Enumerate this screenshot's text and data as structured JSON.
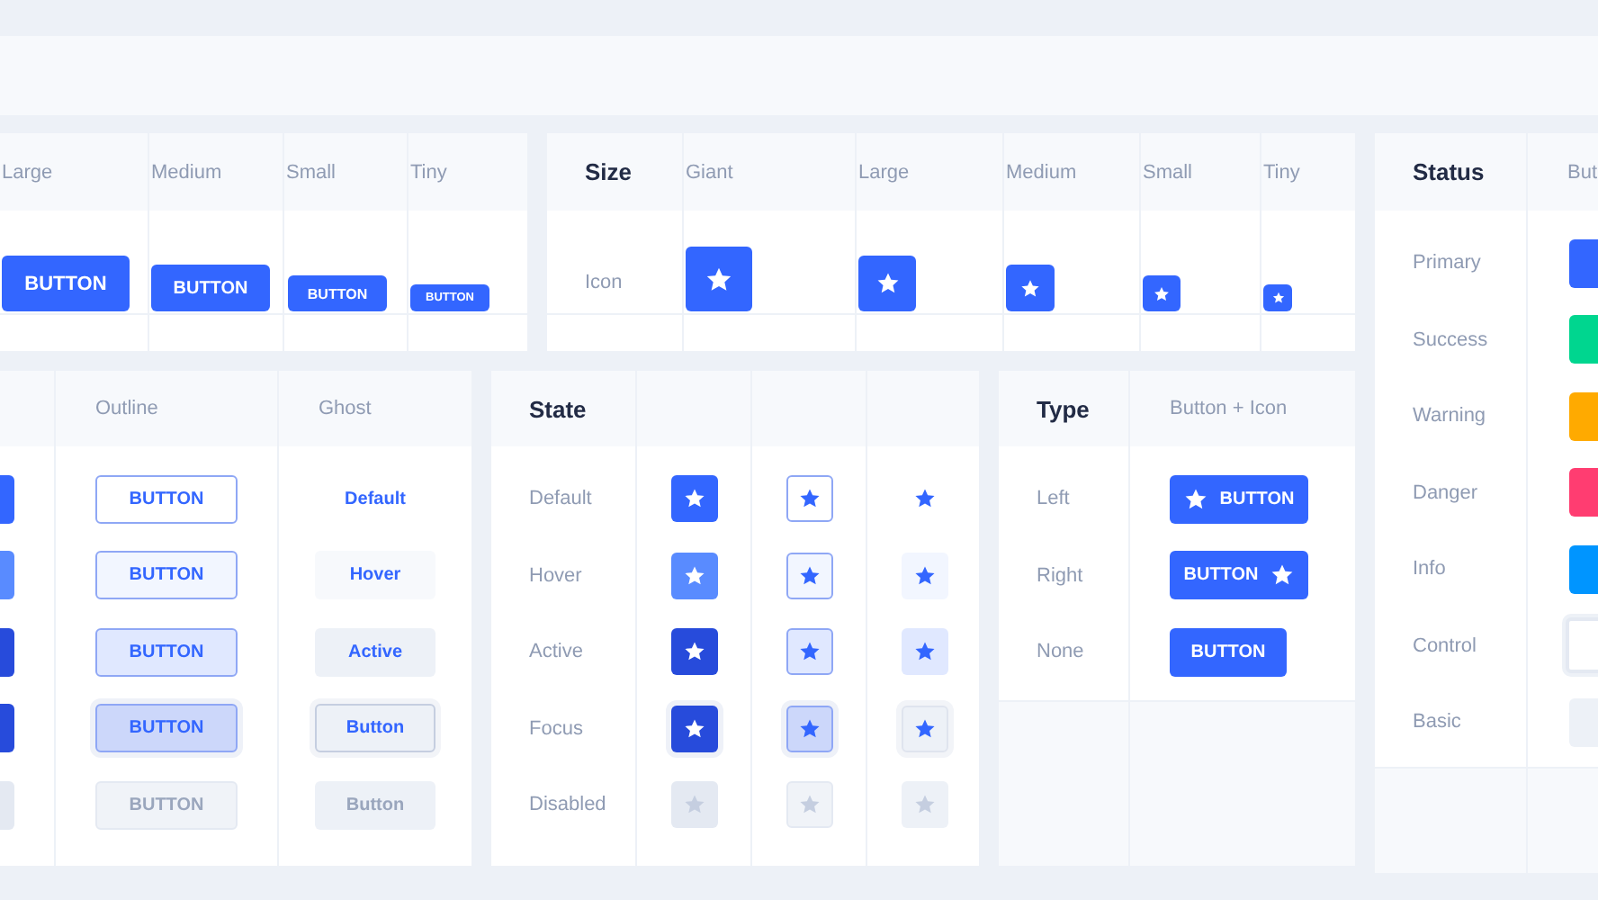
{
  "size_card": {
    "columns": [
      "Large",
      "Medium",
      "Small",
      "Tiny"
    ],
    "buttons": [
      "BUTTON",
      "BUTTON",
      "BUTTON",
      "BUTTON"
    ]
  },
  "icon_size_card": {
    "title": "Size",
    "columns": [
      "Giant",
      "Large",
      "Medium",
      "Small",
      "Tiny"
    ],
    "row_label": "Icon"
  },
  "appearance_card": {
    "columns": [
      "Outline",
      "Ghost"
    ],
    "rows": [
      {
        "kind": "default",
        "outline": "BUTTON",
        "ghost": "Default"
      },
      {
        "kind": "hover",
        "outline": "BUTTON",
        "ghost": "Hover"
      },
      {
        "kind": "active",
        "outline": "BUTTON",
        "ghost": "Active"
      },
      {
        "kind": "focus",
        "outline": "BUTTON",
        "ghost": "Button"
      },
      {
        "kind": "disabled",
        "outline": "BUTTON",
        "ghost": "Button"
      }
    ]
  },
  "state_card": {
    "title": "State",
    "rows": [
      {
        "label": "Default",
        "kind": "default"
      },
      {
        "label": "Hover",
        "kind": "hover"
      },
      {
        "label": "Active",
        "kind": "active"
      },
      {
        "label": "Focus",
        "kind": "focus"
      },
      {
        "label": "Disabled",
        "kind": "disabled"
      }
    ]
  },
  "type_card": {
    "title": "Type",
    "column": "Button + Icon",
    "rows": [
      {
        "label": "Left",
        "kind": "left",
        "button": "BUTTON"
      },
      {
        "label": "Right",
        "kind": "right",
        "button": "BUTTON"
      },
      {
        "label": "None",
        "kind": "none",
        "button": "BUTTON"
      }
    ]
  },
  "status_card": {
    "title": "Status",
    "column": "But",
    "rows": [
      {
        "label": "Primary",
        "kind": "filled",
        "color": "#3366ff"
      },
      {
        "label": "Success",
        "kind": "filled",
        "color": "#00d68f"
      },
      {
        "label": "Warning",
        "kind": "filled",
        "color": "#ffaa00"
      },
      {
        "label": "Danger",
        "kind": "filled",
        "color": "#ff3d71"
      },
      {
        "label": "Info",
        "kind": "filled",
        "color": "#0095ff"
      },
      {
        "label": "Control",
        "kind": "control",
        "color": "#ffffff"
      },
      {
        "label": "Basic",
        "kind": "filled",
        "color": "#edf1f7"
      }
    ]
  }
}
